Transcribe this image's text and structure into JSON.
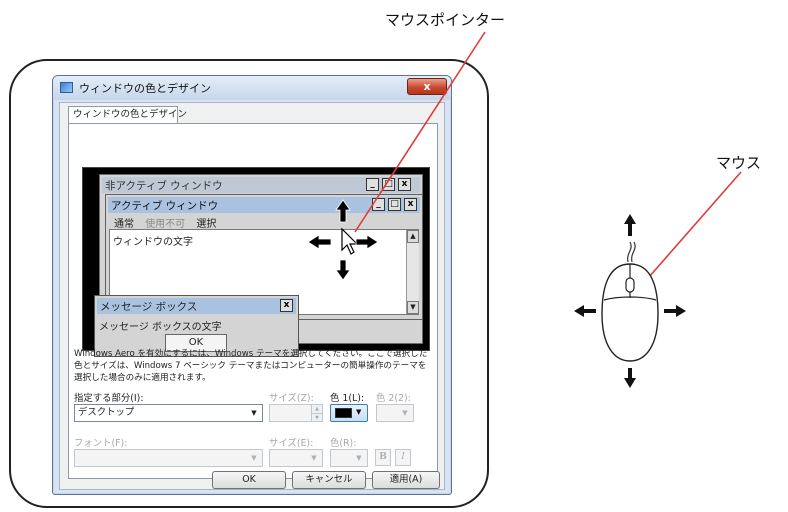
{
  "callouts": {
    "mouse_pointer": "マウスポインター",
    "mouse": "マウス"
  },
  "dialog": {
    "title": "ウィンドウの色とデザイン",
    "close": "x",
    "tab": "ウィンドウの色とデザイン",
    "preview": {
      "inactive_title": "非アクティブ ウィンドウ",
      "active_title": "アクティブ ウィンドウ",
      "window_controls": [
        "_",
        "□",
        "x"
      ],
      "menu": [
        "通常",
        "使用不可",
        "選択"
      ],
      "window_text": "ウィンドウの文字",
      "message_box_title": "メッセージ ボックス",
      "message_box_text": "メッセージ ボックスの文字",
      "message_box_ok": "OK",
      "message_box_close": "x"
    },
    "description": "Windows Aero を有効にするには、Windows テーマを選択してください。ここで選択した色とサイズは、Windows 7 ベーシック テーマまたはコンピューターの簡単操作のテーマを選択した場合のみに適用されます。",
    "item_label": "指定する部分(I):",
    "item_value": "デスクトップ",
    "size_label": "サイズ(Z):",
    "color1_label": "色 1(L):",
    "color2_label": "色 2(2):",
    "font_label": "フォント(F):",
    "font_size_label": "サイズ(E):",
    "font_color_label": "色(R):",
    "bold": "B",
    "italic": "I",
    "buttons": {
      "ok": "OK",
      "cancel": "キャンセル",
      "apply": "適用(A)"
    }
  },
  "colors": {
    "accent": "#3c7fb1",
    "close_button": "#c74a2f",
    "leader_line": "#e23a3a",
    "color1_swatch": "#000000"
  },
  "icons": [
    "window-app-icon",
    "mouse-icon",
    "cursor-arrow-icon",
    "arrow-up-icon",
    "arrow-down-icon",
    "arrow-left-icon",
    "arrow-right-icon"
  ]
}
